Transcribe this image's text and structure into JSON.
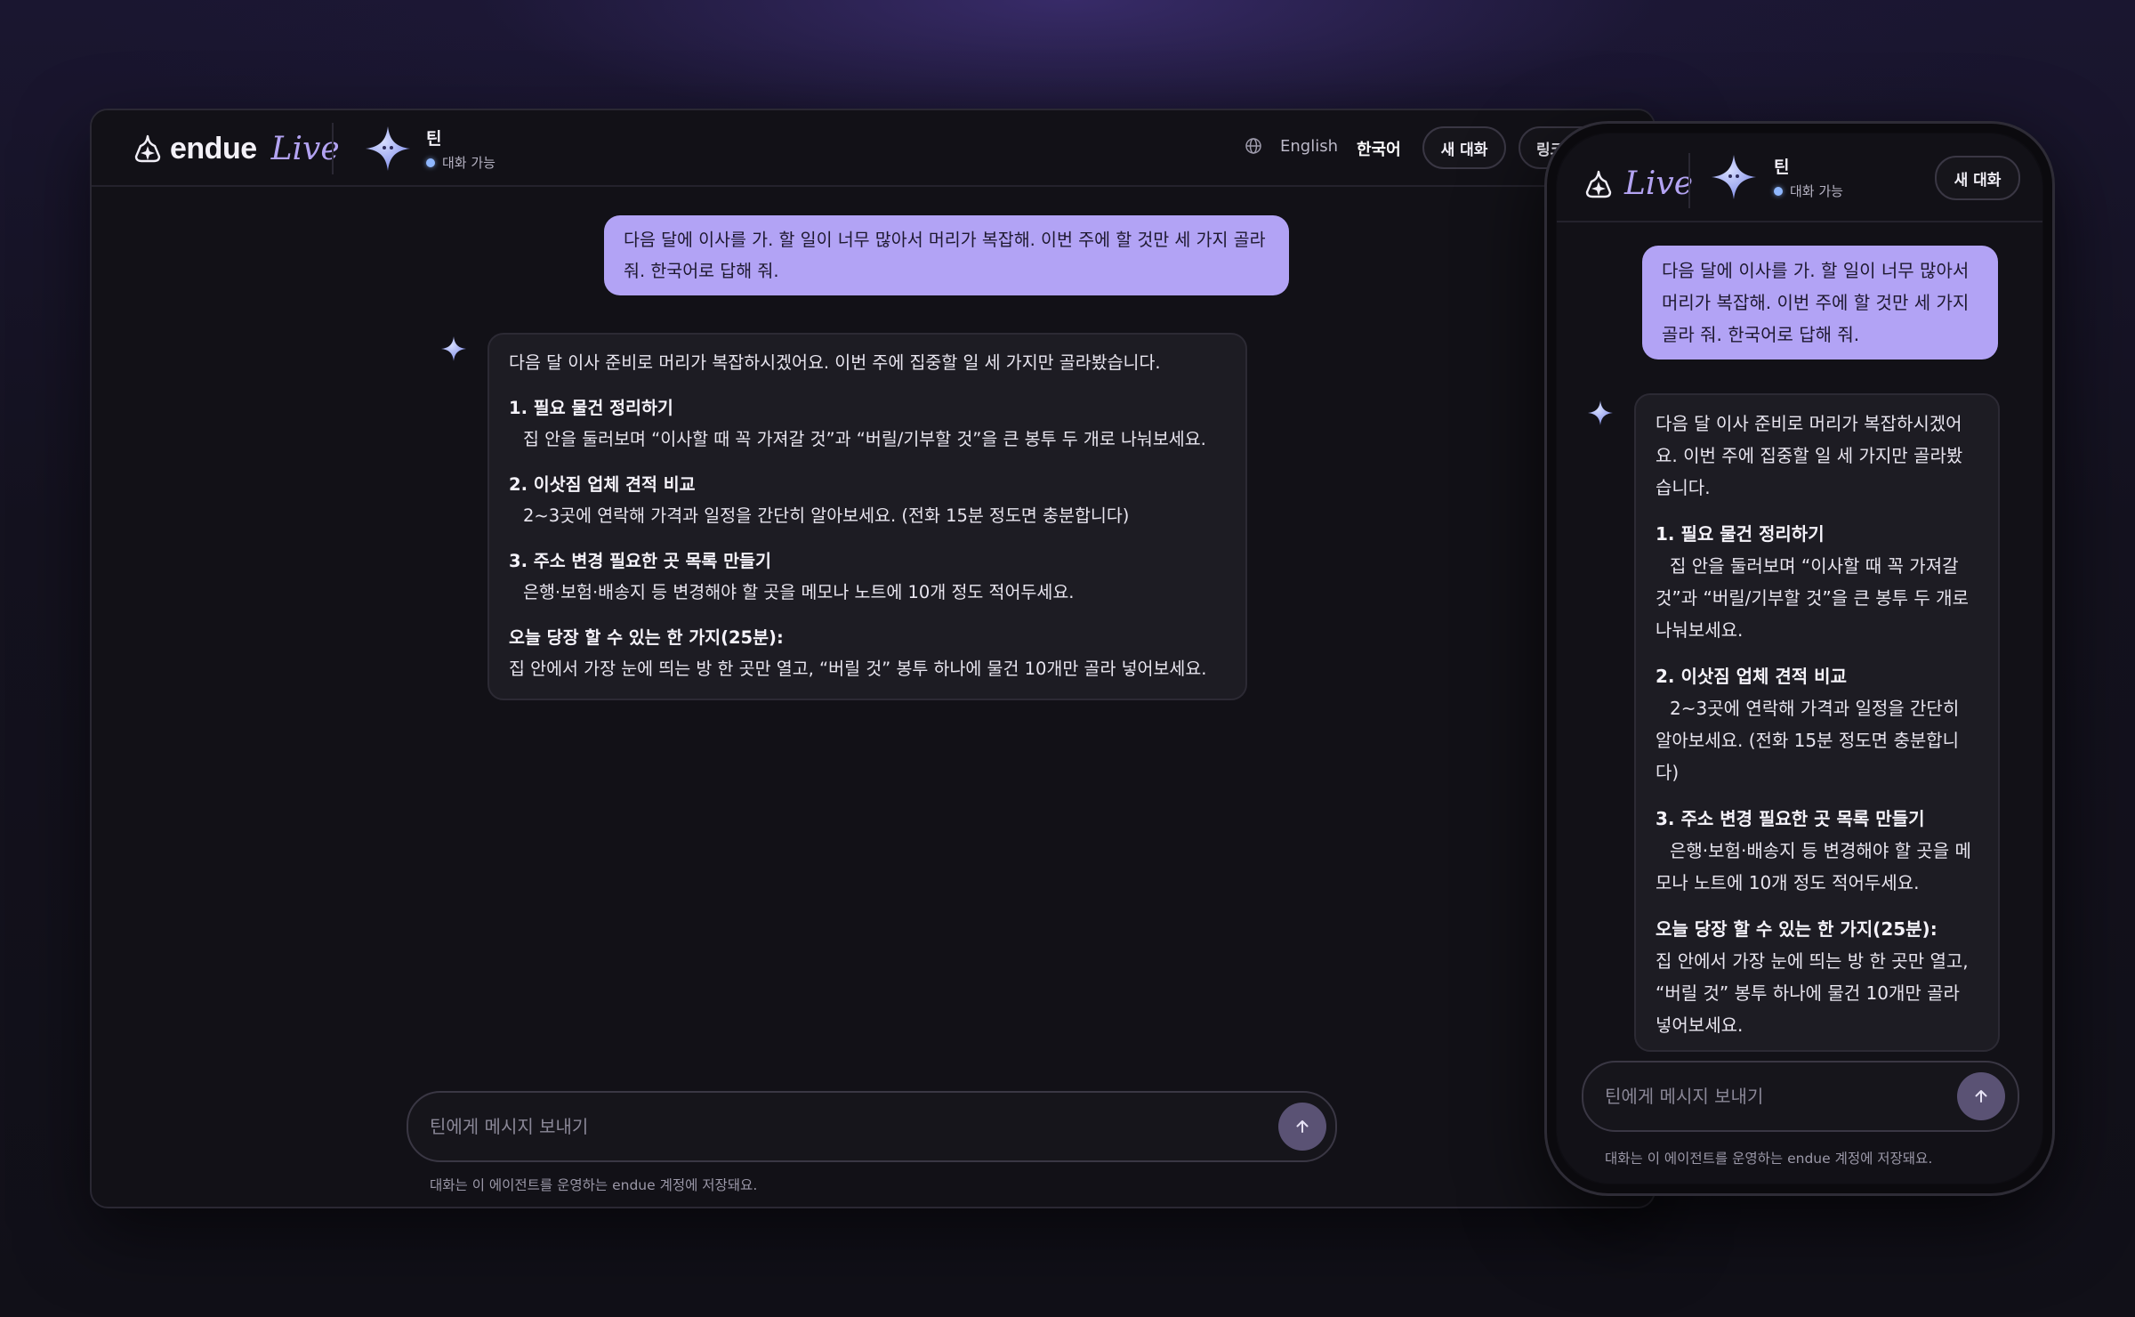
{
  "brand": {
    "name": "endue",
    "live": "Live"
  },
  "agent": {
    "name": "틴",
    "status": "대화 가능"
  },
  "header": {
    "lang_en": "English",
    "lang_ko": "한국어",
    "new_chat": "새 대화",
    "link": "링크"
  },
  "chat": {
    "user_message": "다음 달에 이사를 가. 할 일이 너무 많아서 머리가 복잡해. 이번 주에 할 것만 세 가지 골라 줘. 한국어로 답해 줘.",
    "reply_intro": "다음 달 이사 준비로 머리가 복잡하시겠어요. 이번 주에 집중할 일 세 가지만 골라봤습니다.",
    "items": [
      {
        "title": "1. 필요 물건 정리하기",
        "body": "집 안을 둘러보며 “이사할 때 꼭 가져갈 것”과 “버릴/기부할 것”을 큰 봉투 두 개로 나눠보세요."
      },
      {
        "title": "2. 이삿짐 업체 견적 비교",
        "body": "2~3곳에 연락해 가격과 일정을 간단히 알아보세요. (전화 15분 정도면 충분합니다)"
      },
      {
        "title": "3. 주소 변경 필요한 곳 목록 만들기",
        "body": "은행·보험·배송지 등 변경해야 할 곳을 메모나 노트에 10개 정도 적어두세요."
      }
    ],
    "today_title": "오늘 당장 할 수 있는 한 가지(25분):",
    "today_body": "집 안에서 가장 눈에 띄는 방 한 곳만 열고, “버릴 것” 봉투 하나에 물건 10개만 골라 넣어보세요."
  },
  "composer": {
    "placeholder": "틴에게 메시지 보내기",
    "note": "대화는 이 에이전트를 운영하는 endue 계정에 저장돼요."
  },
  "colors": {
    "accent": "#b2a3f5",
    "background": "#121117",
    "status_dot": "#8fb7ff",
    "send_button": "#5a5274"
  },
  "icons": [
    "endue-logo-icon",
    "agent-star-icon",
    "globe-icon",
    "arrow-up-icon"
  ]
}
